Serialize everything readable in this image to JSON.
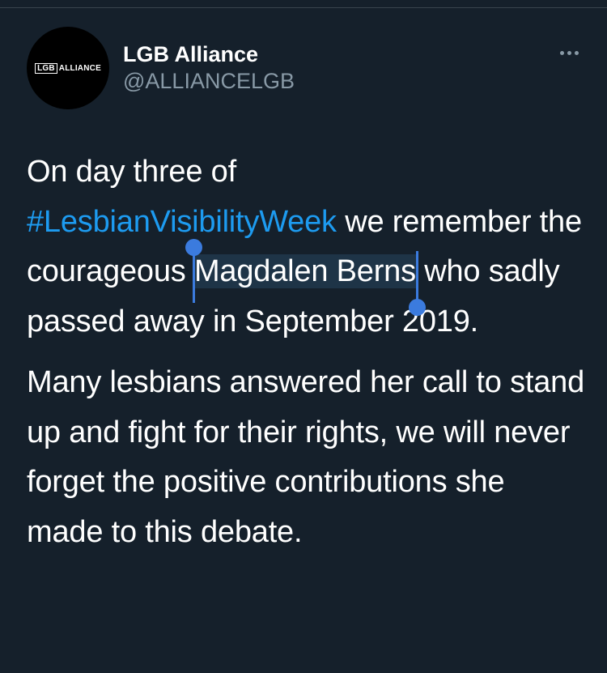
{
  "account": {
    "display_name": "LGB Alliance",
    "handle": "@ALLIANCELGB",
    "avatar_logo_boxed": "LGB",
    "avatar_logo_text": "ALLIANCE"
  },
  "tweet": {
    "p1_before_hashtag": "On day three of ",
    "hashtag": "#LesbianVisibilityWeek",
    "p1_after_hashtag": " we remember the courageous ",
    "selected_text": "Magdalen Berns",
    "p1_after_selection": " who sadly passed away in September 2019.",
    "p2": "Many lesbians answered her call to stand up and fight for their rights, we will never forget the positive contributions she made to this debate."
  },
  "colors": {
    "background": "#15202b",
    "link": "#1d9bf0",
    "secondary_text": "#8899a6",
    "selection_handle": "#3b7bde"
  },
  "icons": {
    "more": "more-horizontal-icon"
  }
}
